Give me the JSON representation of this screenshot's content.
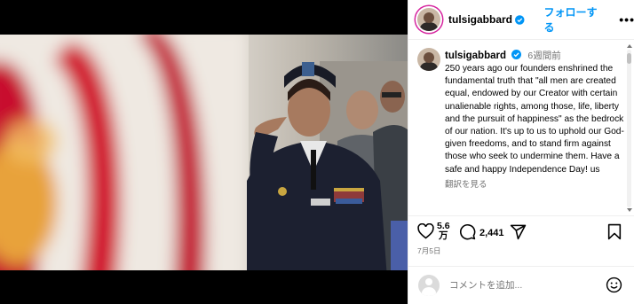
{
  "post": {
    "username": "tulsigabbard",
    "follow_label": "フォローする",
    "more_label": "•••",
    "time_ago": "6週間前",
    "caption": "250 years ago our founders enshrined the fundamental truth that \"all men are created equal, endowed by our Creator with certain unalienable rights, among those, life, liberty and the pursuit of happiness\" as the bedrock of our nation.  It's up to us to uphold our God-given freedoms, and to stand firm against those who seek to undermine them. Have a safe and happy Independence Day! us",
    "translate_label": "翻訳を見る",
    "likes_count_line1": "5.6",
    "likes_count_line2": "万",
    "comments_count": "2,441",
    "date": "7月5日",
    "comment_placeholder": "コメントを追加..."
  },
  "icons": {
    "verified": "verified-badge-icon",
    "like": "heart-icon",
    "comment": "comment-bubble-icon",
    "share": "paper-plane-icon",
    "save": "bookmark-icon",
    "emoji": "smiley-icon",
    "more": "ellipsis-icon"
  },
  "colors": {
    "accent": "#0095f6",
    "verified": "#0095f6",
    "muted": "#737373",
    "border": "#efefef"
  }
}
